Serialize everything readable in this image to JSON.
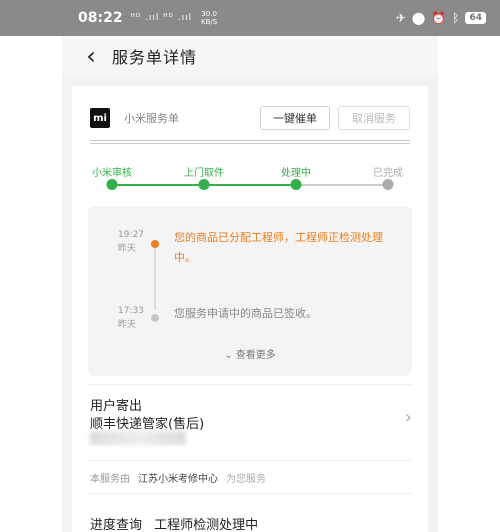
{
  "status_bar": {
    "time": "08:22",
    "signal_text": "ᴴᴰ .ııl ᴴᴰ .ııl",
    "net_speed": "30.0",
    "net_unit": "KB/S",
    "right_icons": [
      "bluetooth-off-icon",
      "location-icon",
      "alarm-icon",
      "bluetooth-icon"
    ],
    "battery": "64"
  },
  "nav": {
    "title": "服务单详情"
  },
  "brand": {
    "logo_text": "mi",
    "name": "小米服务单"
  },
  "buttons": {
    "remind": "一键催单",
    "cancel": "取消服务"
  },
  "progress": {
    "steps": [
      "小米审核",
      "上门取件",
      "处理中",
      "已完成"
    ],
    "completed_count": 3,
    "colors": {
      "active": "#33b049",
      "inactive": "#aaaaaa"
    }
  },
  "timeline": {
    "items": [
      {
        "time": "19:27",
        "day": "昨天",
        "text": "您的商品已分配工程师，工程师正检测处理中。",
        "highlight": true
      },
      {
        "time": "17:33",
        "day": "昨天",
        "text": "您服务申请中的商品已签收。",
        "highlight": false
      }
    ],
    "more_label": "查看更多",
    "accent_color": "#f07d1e"
  },
  "user_delivery": {
    "line1": "用户寄出",
    "line2": "顺丰快递管家(售后)"
  },
  "service_center": {
    "label": "本服务由",
    "name": "江苏小米考修中心",
    "extra": "为您服务"
  },
  "progress_query": {
    "label": "进度查询",
    "value": "工程师检测处理中"
  }
}
